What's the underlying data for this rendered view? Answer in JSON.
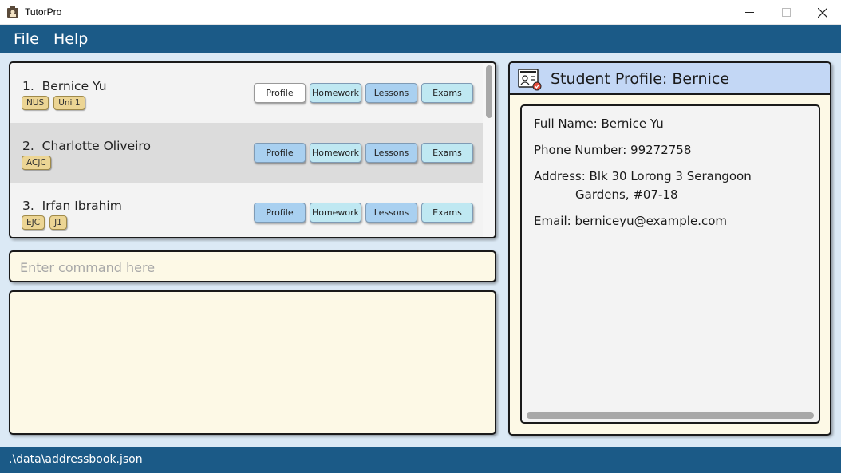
{
  "window": {
    "title": "TutorPro"
  },
  "menu": {
    "file": "File",
    "help": "Help"
  },
  "students": [
    {
      "index": "1.",
      "name": "Bernice Yu",
      "tags": [
        "NUS",
        "Uni 1"
      ],
      "selected": true
    },
    {
      "index": "2.",
      "name": "Charlotte Oliveiro",
      "tags": [
        "ACJC"
      ],
      "selected": false
    },
    {
      "index": "3.",
      "name": "Irfan Ibrahim",
      "tags": [
        "EJC",
        "J1"
      ],
      "selected": false
    }
  ],
  "actions": {
    "profile": "Profile",
    "homework": "Homework",
    "lessons": "Lessons",
    "exams": "Exams"
  },
  "command": {
    "placeholder": "Enter command here",
    "value": ""
  },
  "result": {
    "text": ""
  },
  "profile": {
    "title": "Student Profile: Bernice",
    "full_name": "Full Name: Bernice Yu",
    "phone": "Phone Number: 99272758",
    "address_line1": "Address: Blk 30 Lorong 3 Serangoon",
    "address_line2": "Gardens, #07-18",
    "email": "Email: berniceyu@example.com"
  },
  "status": {
    "path": ".\\data\\addressbook.json"
  },
  "colors": {
    "brand": "#1b5a87",
    "background": "#dbe9f5",
    "tag": "#ecd594",
    "button_dark": "#a9d0f0",
    "button_light": "#bfe8f2",
    "profile_header": "#c3d7f5",
    "input_bg": "#fdf9e6"
  }
}
